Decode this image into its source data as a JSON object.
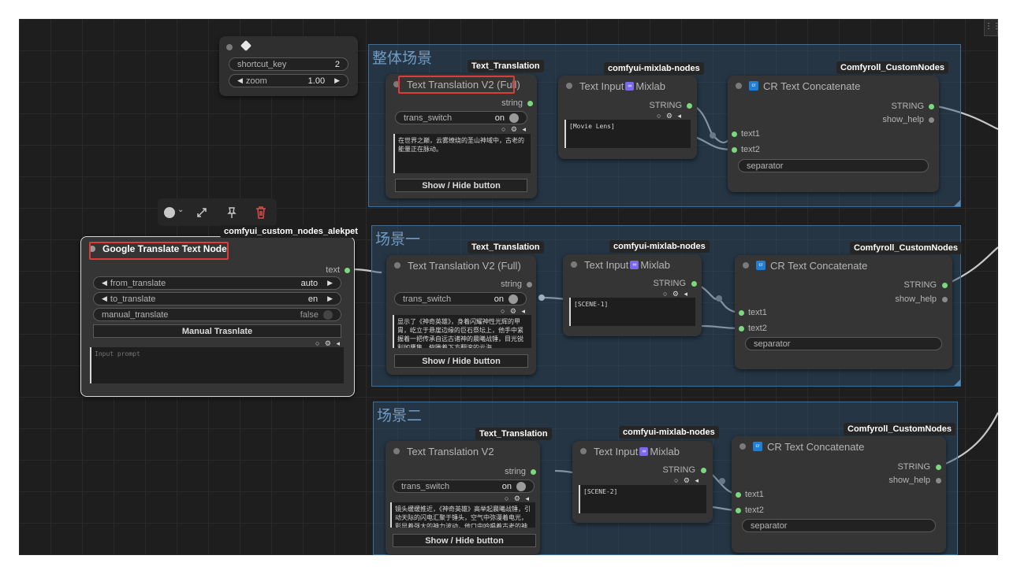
{
  "shortcut_panel": {
    "shortcut_key_label": "shortcut_key",
    "shortcut_key_value": "2",
    "zoom_label": "zoom",
    "zoom_value": "1.00"
  },
  "groups": [
    {
      "title": "整体场景"
    },
    {
      "title": "场景一"
    },
    {
      "title": "场景二"
    }
  ],
  "badges": {
    "text_translation": "Text_Translation",
    "mixlab": "comfyui-mixlab-nodes",
    "comfyroll": "Comfyroll_CustomNodes",
    "alekpet": "comfyui_custom_nodes_alekpet"
  },
  "translation_nodes": [
    {
      "title": "Text Translation V2 (Full)",
      "output": "string",
      "switch_label": "trans_switch",
      "switch_value": "on",
      "text": "在世界之巅，云雾缭绕的圣山神域中，古老的能量正在脉动。",
      "button": "Show / Hide button"
    },
    {
      "title": "Text Translation V2 (Full)",
      "output": "string",
      "switch_label": "trans_switch",
      "switch_value": "on",
      "text": "显示了《神奇英雄》，身着闪耀神性光辉的甲胄，屹立于悬崖边缘的巨石祭坛上，他手中紧握着一把传承自远古诸神的晨曦战锤，目光锐利如鹰隼，俯瞰着下方翻滚的云海。",
      "button": "Show / Hide button"
    },
    {
      "title": "Text Translation V2",
      "output": "string",
      "switch_label": "trans_switch",
      "switch_value": "on",
      "text": "镜头缓缓推近，《神奇英雄》高举起晨曦战锤，引动天际的闪电汇聚于锤头，空气中弥漫着电光，彰显着强大的神力波动，他口中吟唱着古老的神谕，神情肃穆而坚定。",
      "button": "Show / Hide button"
    }
  ],
  "text_input_nodes": [
    {
      "title": "Text Input",
      "brand": "Mixlab",
      "output": "STRING",
      "text": "[Movie Lens]"
    },
    {
      "title": "Text Input",
      "brand": "Mixlab",
      "output": "STRING",
      "text": "[SCENE-1]"
    },
    {
      "title": "Text Input",
      "brand": "Mixlab",
      "output": "STRING",
      "text": "[SCENE-2]"
    }
  ],
  "concat_nodes": [
    {
      "title": "CR Text Concatenate",
      "out1": "STRING",
      "out2": "show_help",
      "in1": "text1",
      "in2": "text2",
      "separator": "separator"
    },
    {
      "title": "CR Text Concatenate",
      "out1": "STRING",
      "out2": "show_help",
      "in1": "text1",
      "in2": "text2",
      "separator": "separator"
    },
    {
      "title": "CR Text Concatenate",
      "out1": "STRING",
      "out2": "show_help",
      "in1": "text1",
      "in2": "text2",
      "separator": "separator"
    }
  ],
  "google_node": {
    "title": "Google Translate Text Node",
    "output": "text",
    "from_label": "from_translate",
    "from_value": "auto",
    "to_label": "to_translate",
    "to_value": "en",
    "manual_label": "manual_translate",
    "manual_value": "false",
    "button": "Manual Trasnlate",
    "placeholder": "Input prompt"
  },
  "colors": {
    "canvas": "#1e1e1e",
    "group_fill": "#2e5274",
    "highlight": "#e03b3b",
    "slot_active": "#7dd87d",
    "delete": "#e04a4a"
  },
  "icons": [
    "diamond-icon",
    "color-circle-icon",
    "pin-icon",
    "delete-icon",
    "link-icon",
    "more-icon"
  ]
}
